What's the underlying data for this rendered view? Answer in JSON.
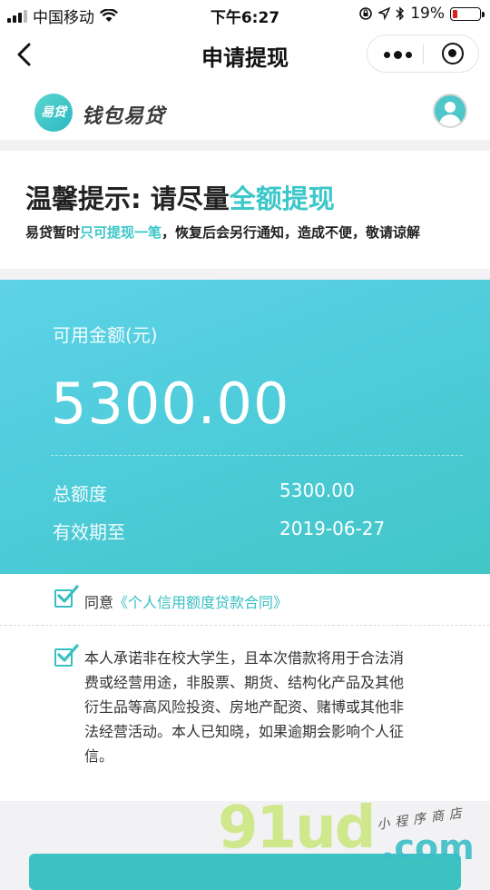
{
  "status_bar": {
    "carrier": "中国移动",
    "time": "下午6:27",
    "battery_percent": "19%",
    "battery_level": 0.19,
    "icons": [
      "signal-icon",
      "wifi-icon",
      "rotation-lock-icon",
      "location-icon",
      "bluetooth-icon",
      "battery-icon"
    ]
  },
  "nav": {
    "title": "申请提现",
    "icons": [
      "back-icon",
      "more-icon",
      "target-icon"
    ]
  },
  "brand": {
    "logo_text": "易贷",
    "name": "钱包易贷",
    "icons": [
      "avatar-icon"
    ]
  },
  "tip": {
    "title_prefix": "温馨提示: 请尽量",
    "title_highlight": "全额提现",
    "sub_prefix": "易贷暂时",
    "sub_highlight": "只可提现一笔",
    "sub_suffix": "，恢复后会另行通知，造成不便，敬请谅解"
  },
  "card": {
    "available_label": "可用金额(元)",
    "available_amount": "5300.00",
    "total_label": "总额度",
    "total_value": "5300.00",
    "expiry_label": "有效期至",
    "expiry_value": "2019-06-27"
  },
  "agreement": {
    "agree_prefix": "同意",
    "contract_link": "《个人信用额度贷款合同》",
    "agree_checked": true,
    "promise_checked": true,
    "promise_lines": [
      "本人承诺非在校大学生，且本次借款将用于合法消",
      "费或经营用途，非股票、期货、结构化产品及其他",
      "衍生品等高风险投资、房地产配资、赌博或其他非",
      "法经营活动。本人已知晓，如果逾期会影响个人征",
      "信。"
    ]
  },
  "watermark": {
    "big": "91ud",
    "com": ".com",
    "small": "小程序商店"
  },
  "colors": {
    "accent": "#3cc7c9",
    "card_gradient_start": "#5ed3e8",
    "card_gradient_end": "#42c6c6"
  }
}
